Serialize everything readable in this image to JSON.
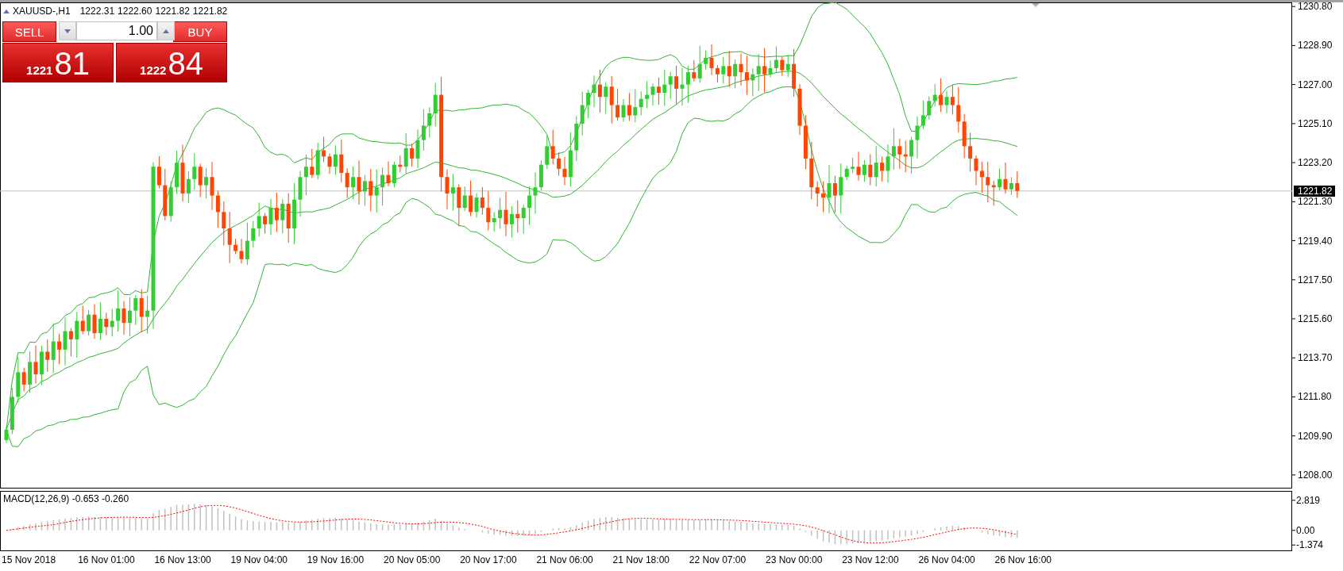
{
  "header": {
    "symbol": "XAUUSD-,H1",
    "quotes": [
      "1222.31",
      "1222.60",
      "1221.82",
      "1221.82"
    ]
  },
  "trade_panel": {
    "sell_label": "SELL",
    "lot": "1.00",
    "buy_label": "BUY",
    "sell_price": {
      "big_figure": "1221",
      "pips": "81"
    },
    "buy_price": {
      "big_figure": "1222",
      "pips": "84"
    }
  },
  "price_chart": {
    "current_price": "1221.82",
    "price_axis": [
      "1230.80",
      "1228.90",
      "1227.00",
      "1225.10",
      "1223.20",
      "1221.30",
      "1219.40",
      "1217.50",
      "1215.60",
      "1213.70",
      "1211.80",
      "1209.90",
      "1208.00"
    ],
    "time_axis": [
      "15 Nov 2018",
      "16 Nov 01:00",
      "16 Nov 13:00",
      "19 Nov 04:00",
      "19 Nov 16:00",
      "20 Nov 05:00",
      "20 Nov 17:00",
      "21 Nov 06:00",
      "21 Nov 18:00",
      "22 Nov 07:00",
      "23 Nov 00:00",
      "23 Nov 12:00",
      "26 Nov 04:00",
      "26 Nov 16:00"
    ]
  },
  "macd": {
    "label": "MACD(12,26,9) -0.653 -0.260",
    "axis": [
      "2.819",
      "0.00",
      "-1.374"
    ]
  }
}
